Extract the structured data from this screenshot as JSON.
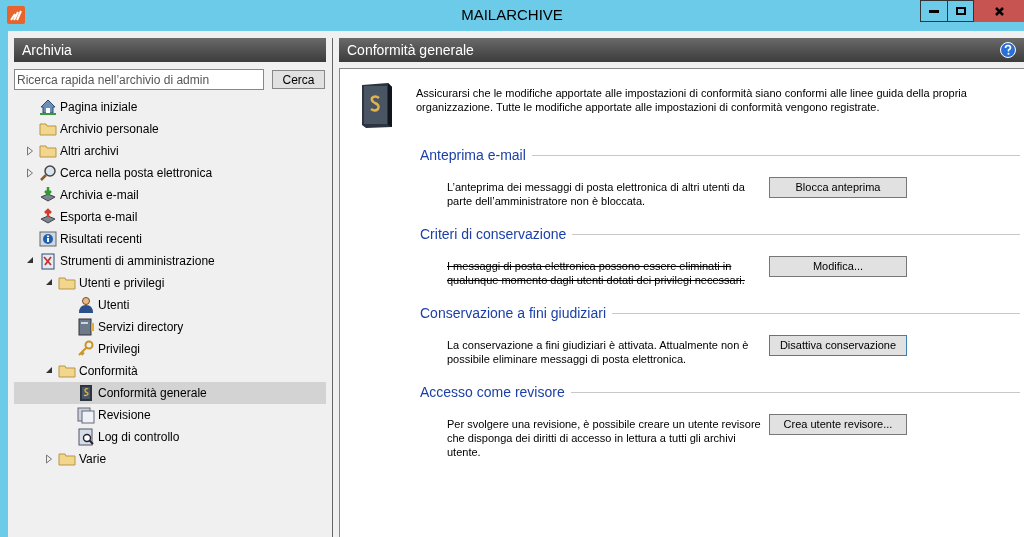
{
  "window": {
    "title": "MAILARCHIVE"
  },
  "sidebar": {
    "title": "Archivia",
    "search": {
      "placeholder": "Ricerca rapida nell’archivio di admin"
    },
    "search_button": "Cerca",
    "items": [
      {
        "label": "Pagina iniziale",
        "kind": "home",
        "selected": false
      },
      {
        "label": "Archivio personale",
        "kind": "folder",
        "selected": false
      },
      {
        "label": "Altri archivi",
        "kind": "folder",
        "selected": false,
        "expanded": false
      },
      {
        "label": "Cerca nella posta elettronica",
        "kind": "search",
        "selected": false,
        "expanded": false
      },
      {
        "label": "Archivia e-mail",
        "kind": "import",
        "selected": false
      },
      {
        "label": "Esporta e-mail",
        "kind": "export",
        "selected": false
      },
      {
        "label": "Risultati recenti",
        "kind": "info",
        "selected": false
      },
      {
        "label": "Strumenti di amministrazione",
        "kind": "tools",
        "selected": false,
        "expanded": true,
        "children": [
          {
            "label": "Utenti e privilegi",
            "kind": "folder",
            "selected": false,
            "expanded": true,
            "children": [
              {
                "label": "Utenti",
                "kind": "user",
                "selected": false
              },
              {
                "label": "Servizi directory",
                "kind": "directory",
                "selected": false
              },
              {
                "label": "Privilegi",
                "kind": "key",
                "selected": false
              }
            ]
          },
          {
            "label": "Conformità",
            "kind": "folder",
            "selected": false,
            "expanded": true,
            "children": [
              {
                "label": "Conformità generale",
                "kind": "law",
                "selected": true
              },
              {
                "label": "Revisione",
                "kind": "audit",
                "selected": false
              },
              {
                "label": "Log di controllo",
                "kind": "log",
                "selected": false
              }
            ]
          },
          {
            "label": "Varie",
            "kind": "folder",
            "selected": false,
            "expanded": false
          }
        ]
      }
    ]
  },
  "main": {
    "title": "Conformità generale",
    "intro": "Assicurarsi che le modifiche apportate alle impostazioni di conformità siano conformi alle linee guida della propria organizzazione. Tutte le modifiche apportate alle impostazioni di conformità vengono registrate.",
    "sections": [
      {
        "title": "Anteprima e-mail",
        "text": "L’anteprima dei messaggi di posta elettronica di altri utenti da parte dell’amministratore non è bloccata.",
        "struck": false,
        "button": "Blocca anteprima",
        "focused": false
      },
      {
        "title": "Criteri di conservazione",
        "text": "I messaggi di posta elettronica possono essere eliminati in qualunque momento dagli utenti dotati dei privilegi necessari.",
        "struck": true,
        "button": "Modifica...",
        "focused": false
      },
      {
        "title": "Conservazione a fini giudiziari",
        "text": "La conservazione a fini giudiziari è attivata. Attualmente non è possibile eliminare messaggi di posta elettronica.",
        "struck": false,
        "button": "Disattiva conservazione",
        "focused": true
      },
      {
        "title": "Accesso come revisore",
        "text": "Per svolgere una revisione, è possibile creare un utente revisore che disponga dei diritti di accesso in lettura a tutti gli archivi utente.",
        "struck": false,
        "button": "Crea utente revisore...",
        "focused": false
      }
    ]
  }
}
